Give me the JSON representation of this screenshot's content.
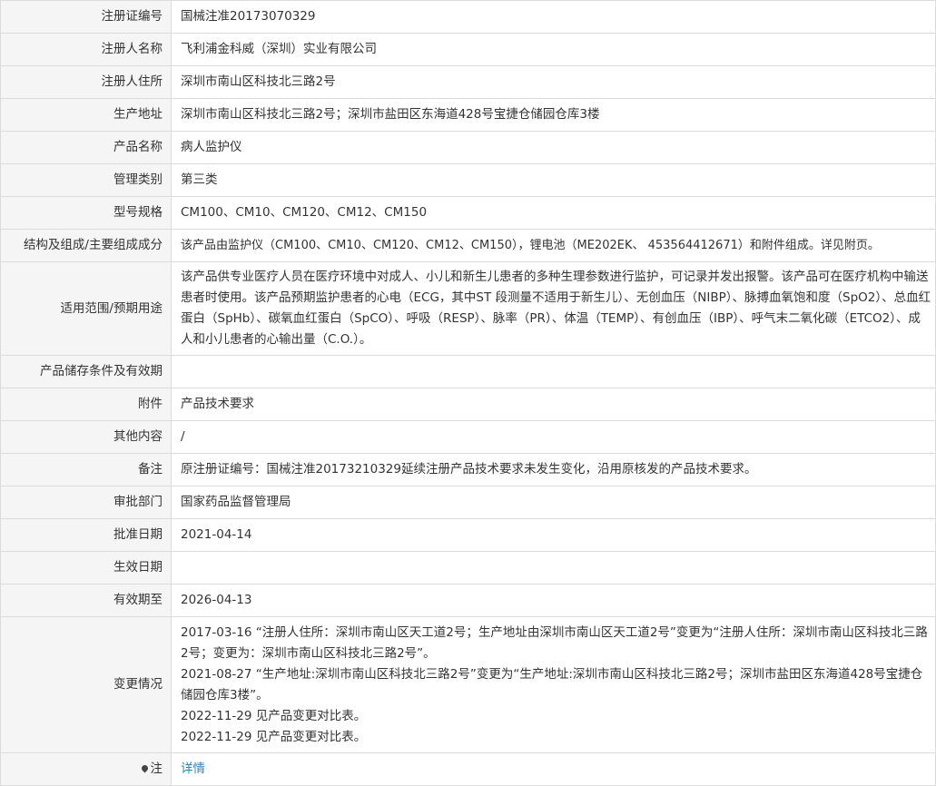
{
  "rows": [
    {
      "label": "注册证编号",
      "value": "国械注准20173070329"
    },
    {
      "label": "注册人名称",
      "value": "飞利浦金科威（深圳）实业有限公司"
    },
    {
      "label": "注册人住所",
      "value": "深圳市南山区科技北三路2号"
    },
    {
      "label": "生产地址",
      "value": "深圳市南山区科技北三路2号；深圳市盐田区东海道428号宝捷仓储园仓库3楼"
    },
    {
      "label": "产品名称",
      "value": "病人监护仪"
    },
    {
      "label": "管理类别",
      "value": "第三类"
    },
    {
      "label": "型号规格",
      "value": "CM100、CM10、CM120、CM12、CM150"
    },
    {
      "label": "结构及组成/主要组成成分",
      "value": "该产品由监护仪（CM100、CM10、CM120、CM12、CM150），锂电池（ME202EK、 453564412671）和附件组成。详见附页。"
    },
    {
      "label": "适用范围/预期用途",
      "value": "该产品供专业医疗人员在医疗环境中对成人、小儿和新生儿患者的多种生理参数进行监护，可记录并发出报警。该产品可在医疗机构中输送患者时使用。该产品预期监护患者的心电（ECG，其中ST 段测量不适用于新生儿）、无创血压（NIBP）、脉搏血氧饱和度（SpO2）、总血红蛋白（SpHb）、碳氧血红蛋白（SpCO）、呼吸（RESP）、脉率（PR）、体温（TEMP）、有创血压（IBP）、呼气末二氧化碳（ETCO2）、成人和小儿患者的心输出量（C.O.）。"
    },
    {
      "label": "产品储存条件及有效期",
      "value": ""
    },
    {
      "label": "附件",
      "value": "产品技术要求"
    },
    {
      "label": "其他内容",
      "value": "/"
    },
    {
      "label": "备注",
      "value": "原注册证编号：国械注准20173210329延续注册产品技术要求未发生变化，沿用原核发的产品技术要求。"
    },
    {
      "label": "审批部门",
      "value": "国家药品监督管理局"
    },
    {
      "label": "批准日期",
      "value": "2021-04-14"
    },
    {
      "label": "生效日期",
      "value": ""
    },
    {
      "label": "有效期至",
      "value": "2026-04-13"
    }
  ],
  "changes": {
    "label": "变更情况",
    "lines": [
      "2017-03-16 “注册人住所：深圳市南山区天工道2号；生产地址由深圳市南山区天工道2号”变更为“注册人住所：深圳市南山区科技北三路2号；变更为：深圳市南山区科技北三路2号”。",
      "2021-08-27 “生产地址:深圳市南山区科技北三路2号”变更为“生产地址:深圳市南山区科技北三路2号；深圳市盐田区东海道428号宝捷仓储园仓库3楼”。",
      "2022-11-29 见产品变更对比表。",
      "2022-11-29 见产品变更对比表。"
    ]
  },
  "note": {
    "label": "注",
    "icon": "map-pin-icon",
    "link_text": "详情",
    "link_color": "#2a82c8"
  }
}
